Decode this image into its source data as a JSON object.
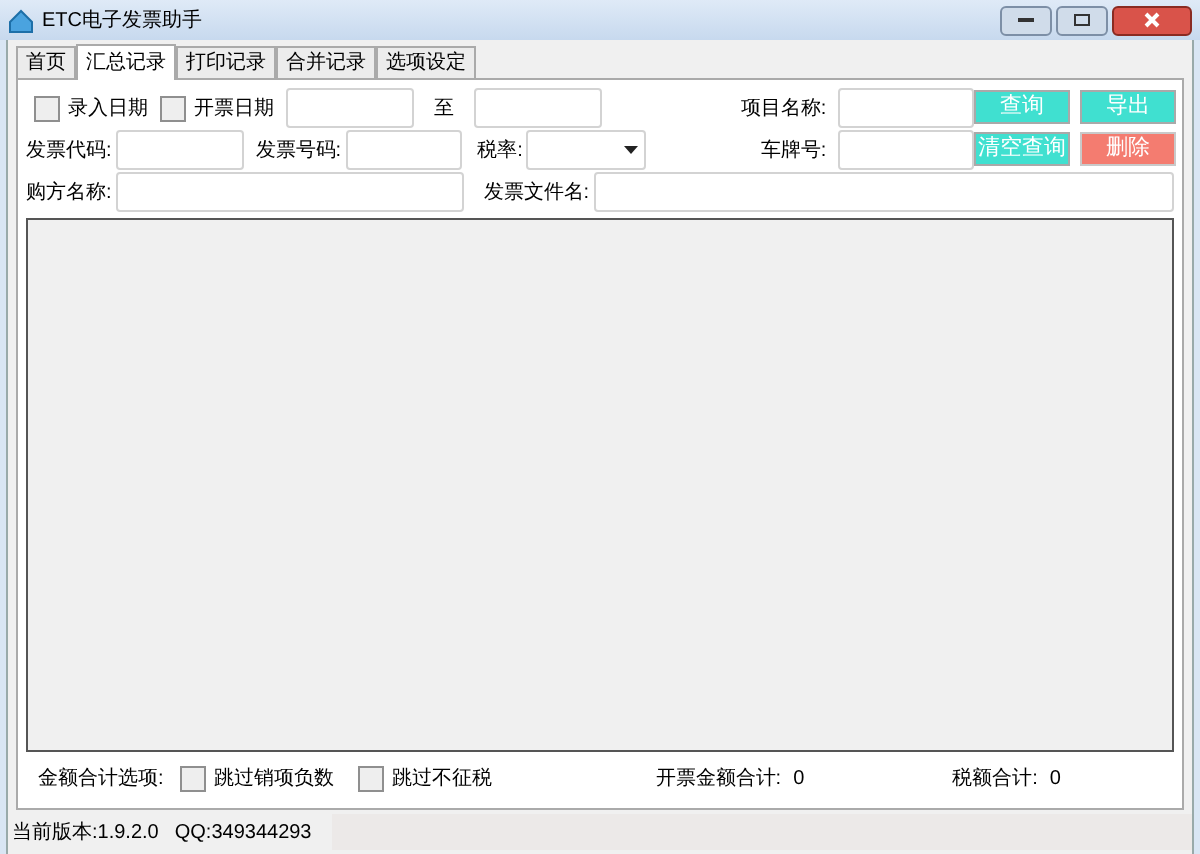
{
  "window": {
    "title": "ETC电子发票助手"
  },
  "tabs": [
    {
      "label": "首页",
      "selected": false
    },
    {
      "label": "汇总记录",
      "selected": true
    },
    {
      "label": "打印记录",
      "selected": false
    },
    {
      "label": "合并记录",
      "selected": false
    },
    {
      "label": "选项设定",
      "selected": false
    }
  ],
  "filters": {
    "entry_date": {
      "label": "录入日期",
      "checked": false
    },
    "invoice_date": {
      "label": "开票日期",
      "checked": false
    },
    "to_label": "至",
    "project_name_label": "项目名称:",
    "invoice_code_label": "发票代码:",
    "invoice_number_label": "发票号码:",
    "tax_rate_label": "税率:",
    "plate_label": "车牌号:",
    "buyer_label": "购方名称:",
    "file_name_label": "发票文件名:"
  },
  "buttons": [
    {
      "label": "查询",
      "kind": "primary"
    },
    {
      "label": "导出",
      "kind": "primary"
    },
    {
      "label": "清空查询",
      "kind": "primary"
    },
    {
      "label": "删除",
      "kind": "danger"
    }
  ],
  "totals": {
    "options_label": "金额合计选项:",
    "skip_negative": {
      "label": "跳过销项负数",
      "checked": false
    },
    "skip_untaxed": {
      "label": "跳过不征税",
      "checked": false
    },
    "amount_label": "开票金额合计:",
    "amount": "0",
    "tax_label": "税额合计:",
    "tax": "0"
  },
  "status_bar": {
    "version": "当前版本:1.9.2.0",
    "qq": "QQ:349344293"
  }
}
